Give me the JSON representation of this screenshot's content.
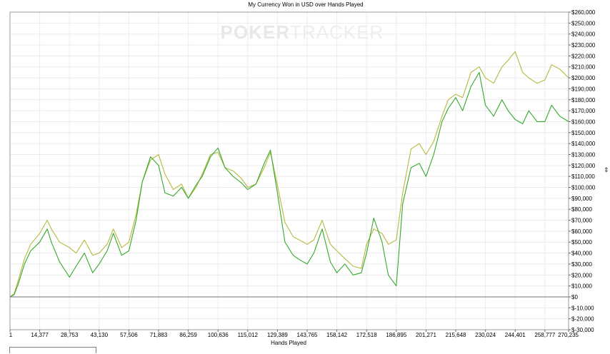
{
  "chart_data": {
    "type": "line",
    "title": "My Currency Won in USD over Hands Played",
    "xlabel": "Hands Played",
    "ylabel": "",
    "watermark": {
      "left": "POKER",
      "right": "TRACKER"
    },
    "axis_marker": "⇕",
    "xlim": [
      1,
      270235
    ],
    "ylim": [
      -30000,
      260000
    ],
    "x_ticks": [
      1,
      14377,
      28753,
      43130,
      57506,
      71883,
      86259,
      100636,
      115012,
      129389,
      143765,
      158142,
      172518,
      186895,
      201271,
      215648,
      230024,
      244401,
      258777,
      270235
    ],
    "x_tick_labels": [
      "1",
      "14,377",
      "28,753",
      "43,130",
      "57,506",
      "71,883",
      "86,259",
      "100,636",
      "115,012",
      "129,389",
      "143,765",
      "158,142",
      "172,518",
      "186,895",
      "201,271",
      "215,648",
      "230,024",
      "244,401",
      "258,777",
      "270,235"
    ],
    "y_ticks": [
      260000,
      250000,
      240000,
      230000,
      220000,
      210000,
      200000,
      190000,
      180000,
      170000,
      160000,
      150000,
      140000,
      130000,
      120000,
      110000,
      100000,
      90000,
      80000,
      70000,
      60000,
      50000,
      40000,
      30000,
      20000,
      10000,
      0,
      -10000,
      -20000,
      -30000
    ],
    "y_tick_labels": [
      "$260,000",
      "$250,000",
      "$240,000",
      "$230,000",
      "$220,000",
      "$210,000",
      "$200,000",
      "$190,000",
      "$180,000",
      "$170,000",
      "$160,000",
      "$150,000",
      "$140,000",
      "$130,000",
      "$120,000",
      "$110,000",
      "$100,000",
      "$90,000",
      "$80,000",
      "$70,000",
      "$60,000",
      "$50,000",
      "$40,000",
      "$30,000",
      "$20,000",
      "$10,000",
      "$0",
      "$-10,000",
      "$-20,000",
      "$-30,000"
    ],
    "grid": true,
    "zero_line": true,
    "series": [
      {
        "color": "#b5b83c",
        "x": [
          1,
          2000,
          4000,
          7000,
          10000,
          14377,
          18000,
          20000,
          24000,
          28753,
          32000,
          36000,
          40000,
          43130,
          47000,
          50000,
          54000,
          57506,
          61000,
          64000,
          68000,
          71883,
          75000,
          79000,
          83000,
          86259,
          90000,
          93000,
          97000,
          100636,
          104000,
          108000,
          112000,
          115012,
          119000,
          123000,
          126000,
          129389,
          133000,
          137000,
          140000,
          143765,
          147000,
          151000,
          155000,
          158142,
          162000,
          166000,
          170000,
          172518,
          176000,
          180000,
          183000,
          186895,
          190000,
          194000,
          198000,
          201271,
          205000,
          209000,
          212000,
          215648,
          219000,
          223000,
          227000,
          230024,
          234000,
          238000,
          241000,
          244401,
          248000,
          251000,
          255000,
          258777,
          262000,
          266000,
          270235
        ],
        "values": [
          0,
          3000,
          15000,
          35000,
          48000,
          58000,
          70000,
          62000,
          50000,
          45000,
          40000,
          52000,
          38000,
          40000,
          48000,
          62000,
          45000,
          50000,
          75000,
          105000,
          125000,
          130000,
          112000,
          98000,
          103000,
          90000,
          100000,
          112000,
          130000,
          132000,
          118000,
          115000,
          108000,
          100000,
          103000,
          118000,
          132000,
          102000,
          68000,
          55000,
          52000,
          48000,
          52000,
          70000,
          48000,
          42000,
          35000,
          28000,
          26000,
          48000,
          62000,
          58000,
          48000,
          52000,
          95000,
          135000,
          140000,
          130000,
          142000,
          165000,
          180000,
          185000,
          182000,
          205000,
          210000,
          200000,
          195000,
          210000,
          216000,
          224000,
          205000,
          200000,
          195000,
          198000,
          212000,
          208000,
          200000
        ]
      },
      {
        "color": "#35a82c",
        "x": [
          1,
          2000,
          4000,
          7000,
          10000,
          14377,
          18000,
          20000,
          24000,
          28753,
          32000,
          36000,
          40000,
          43130,
          47000,
          50000,
          54000,
          57506,
          61000,
          64000,
          68000,
          71883,
          75000,
          79000,
          83000,
          86259,
          90000,
          93000,
          97000,
          100636,
          104000,
          108000,
          112000,
          115012,
          119000,
          123000,
          126000,
          129389,
          133000,
          137000,
          140000,
          143765,
          147000,
          151000,
          155000,
          158142,
          162000,
          166000,
          170000,
          172518,
          176000,
          180000,
          183000,
          186895,
          190000,
          194000,
          198000,
          201271,
          205000,
          209000,
          212000,
          215648,
          219000,
          223000,
          227000,
          230024,
          234000,
          238000,
          241000,
          244401,
          248000,
          251000,
          255000,
          258777,
          262000,
          266000,
          270235
        ],
        "values": [
          0,
          2000,
          12000,
          30000,
          42000,
          50000,
          62000,
          50000,
          32000,
          18000,
          28000,
          40000,
          22000,
          30000,
          42000,
          58000,
          38000,
          42000,
          70000,
          105000,
          128000,
          120000,
          95000,
          92000,
          100000,
          90000,
          102000,
          110000,
          128000,
          136000,
          118000,
          110000,
          104000,
          98000,
          103000,
          122000,
          134000,
          95000,
          50000,
          38000,
          34000,
          30000,
          40000,
          62000,
          32000,
          22000,
          30000,
          20000,
          22000,
          40000,
          72000,
          50000,
          20000,
          10000,
          85000,
          118000,
          122000,
          110000,
          130000,
          160000,
          172000,
          182000,
          170000,
          192000,
          205000,
          175000,
          165000,
          180000,
          170000,
          162000,
          158000,
          170000,
          160000,
          160000,
          175000,
          165000,
          160000
        ]
      }
    ]
  }
}
